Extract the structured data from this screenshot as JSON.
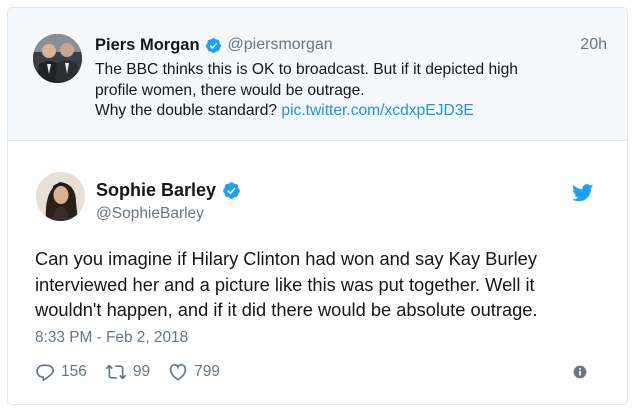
{
  "quoted_tweet": {
    "name": "Piers Morgan",
    "handle": "@piersmorgan",
    "time": "20h",
    "text_line1": "The BBC thinks this is OK to broadcast. But if it depicted high",
    "text_line2": "profile women, there would be outrage.",
    "text_line3": "Why the double standard?",
    "link": "pic.twitter.com/xcdxpEJD3E",
    "avatar_icon": "profile-photo",
    "verified_icon": "verified-badge-icon"
  },
  "main_tweet": {
    "name": "Sophie Barley",
    "handle": "@SophieBarley",
    "text_line1": "Can you imagine if Hilary Clinton had won and say Kay Burley",
    "text_line2": "interviewed her and a picture like this was put together. Well it",
    "text_line3": "wouldn't happen, and if it did there would be absolute outrage.",
    "date": "8:33 PM - Feb 2, 2018",
    "replies": "156",
    "retweets": "99",
    "likes": "799",
    "avatar_icon": "profile-photo",
    "platform_icon": "twitter-bird-icon",
    "info_icon": "info-icon"
  },
  "colors": {
    "link_blue": "#1b95e0",
    "muted_gray": "#657786",
    "text_dark": "#14171a",
    "quoted_bg": "#f5f8fa",
    "border": "#e1e8ed"
  }
}
